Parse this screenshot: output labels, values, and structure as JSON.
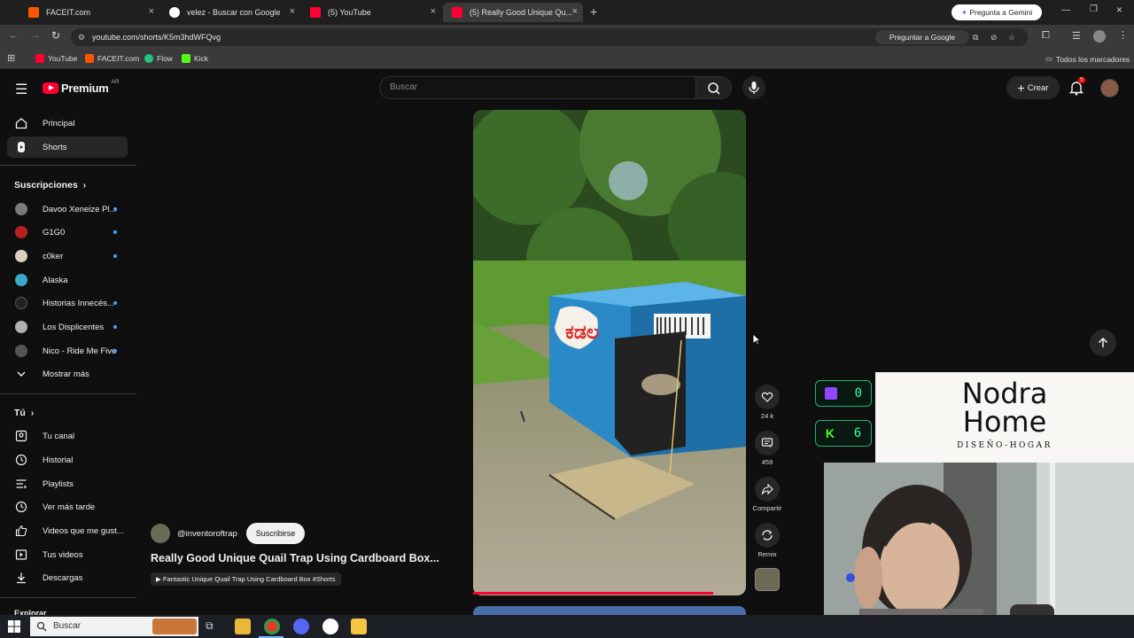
{
  "browser": {
    "tabs": [
      {
        "label": "FACEIT.com",
        "favicon_color": "#ff5500",
        "active": false
      },
      {
        "label": "velez - Buscar con Google",
        "favicon_color": "#ffffff",
        "active": false
      },
      {
        "label": "(5) YouTube",
        "favicon_color": "#ff0033",
        "active": false
      },
      {
        "label": "(5) Really Good Unique Qu...",
        "favicon_color": "#ff0033",
        "active": true
      }
    ],
    "gemini_label": "Pregunta a Gemini",
    "url": "youtube.com/shorts/K5m3hdWFQvg",
    "ask_google": "Preguntar a Google",
    "bookmarks": [
      "YouTube",
      "FACEIT.com",
      "Flow",
      "Kick"
    ],
    "all_bookmarks": "Todos los marcadores"
  },
  "youtube": {
    "logo_text": "Premium",
    "logo_region": "AR",
    "search_placeholder": "Buscar",
    "create_label": "Crear",
    "notification_count": "5"
  },
  "sidebar": {
    "main": [
      {
        "label": "Principal",
        "icon": "home-icon",
        "active": false
      },
      {
        "label": "Shorts",
        "icon": "shorts-icon",
        "active": true
      }
    ],
    "subscriptions_title": "Suscripciones",
    "subscriptions": [
      {
        "label": "Davoo Xeneize Pl...",
        "avatar_color": "#7a7a7a"
      },
      {
        "label": "G1G0",
        "avatar_color": "#b82020"
      },
      {
        "label": "c0ker",
        "avatar_color": "#d9d0c0"
      },
      {
        "label": "Alaska",
        "avatar_color": "#3aa8c8"
      },
      {
        "label": "Historias Innecés...",
        "avatar_color": "#222222"
      },
      {
        "label": "Los Displicentes",
        "avatar_color": "#b0b0b0"
      },
      {
        "label": "Nico - Ride Me Five",
        "avatar_color": "#555555"
      }
    ],
    "show_more": "Mostrar más",
    "you_title": "Tú",
    "you": [
      {
        "label": "Tu canal",
        "icon": "user-icon"
      },
      {
        "label": "Historial",
        "icon": "history-icon"
      },
      {
        "label": "Playlists",
        "icon": "playlist-icon"
      },
      {
        "label": "Ver más tarde",
        "icon": "clock-icon"
      },
      {
        "label": "Videos que me gust...",
        "icon": "thumbs-up-icon"
      },
      {
        "label": "Tus videos",
        "icon": "video-icon"
      },
      {
        "label": "Descargas",
        "icon": "download-icon"
      }
    ],
    "explore_title": "Explorar"
  },
  "short": {
    "channel": "@inventoroftrap",
    "subscribe_label": "Suscribirse",
    "title": "Really Good Unique Quail Trap Using Cardboard Box...",
    "playlist": "Fantastic Unique Quail Trap Using Cardboard Box #Shorts",
    "likes": "24 k",
    "comments": "459",
    "share_label": "Compartir",
    "remix_label": "Remix",
    "progress": 0.88
  },
  "overlay": {
    "twitch_count": "0",
    "kick_count": "6",
    "brand_line1": "Nodra",
    "brand_line2": "Home",
    "brand_tagline": "DISEÑO-HOGAR"
  },
  "taskbar": {
    "search_placeholder": "Buscar"
  }
}
